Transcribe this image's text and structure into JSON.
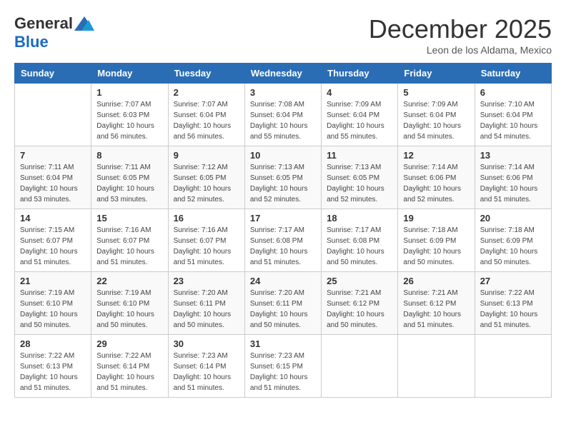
{
  "header": {
    "logo_general": "General",
    "logo_blue": "Blue",
    "month_title": "December 2025",
    "location": "Leon de los Aldama, Mexico"
  },
  "days_of_week": [
    "Sunday",
    "Monday",
    "Tuesday",
    "Wednesday",
    "Thursday",
    "Friday",
    "Saturday"
  ],
  "weeks": [
    [
      {
        "num": "",
        "sunrise": "",
        "sunset": "",
        "daylight": ""
      },
      {
        "num": "1",
        "sunrise": "Sunrise: 7:07 AM",
        "sunset": "Sunset: 6:03 PM",
        "daylight": "Daylight: 10 hours and 56 minutes."
      },
      {
        "num": "2",
        "sunrise": "Sunrise: 7:07 AM",
        "sunset": "Sunset: 6:04 PM",
        "daylight": "Daylight: 10 hours and 56 minutes."
      },
      {
        "num": "3",
        "sunrise": "Sunrise: 7:08 AM",
        "sunset": "Sunset: 6:04 PM",
        "daylight": "Daylight: 10 hours and 55 minutes."
      },
      {
        "num": "4",
        "sunrise": "Sunrise: 7:09 AM",
        "sunset": "Sunset: 6:04 PM",
        "daylight": "Daylight: 10 hours and 55 minutes."
      },
      {
        "num": "5",
        "sunrise": "Sunrise: 7:09 AM",
        "sunset": "Sunset: 6:04 PM",
        "daylight": "Daylight: 10 hours and 54 minutes."
      },
      {
        "num": "6",
        "sunrise": "Sunrise: 7:10 AM",
        "sunset": "Sunset: 6:04 PM",
        "daylight": "Daylight: 10 hours and 54 minutes."
      }
    ],
    [
      {
        "num": "7",
        "sunrise": "Sunrise: 7:11 AM",
        "sunset": "Sunset: 6:04 PM",
        "daylight": "Daylight: 10 hours and 53 minutes."
      },
      {
        "num": "8",
        "sunrise": "Sunrise: 7:11 AM",
        "sunset": "Sunset: 6:05 PM",
        "daylight": "Daylight: 10 hours and 53 minutes."
      },
      {
        "num": "9",
        "sunrise": "Sunrise: 7:12 AM",
        "sunset": "Sunset: 6:05 PM",
        "daylight": "Daylight: 10 hours and 52 minutes."
      },
      {
        "num": "10",
        "sunrise": "Sunrise: 7:13 AM",
        "sunset": "Sunset: 6:05 PM",
        "daylight": "Daylight: 10 hours and 52 minutes."
      },
      {
        "num": "11",
        "sunrise": "Sunrise: 7:13 AM",
        "sunset": "Sunset: 6:05 PM",
        "daylight": "Daylight: 10 hours and 52 minutes."
      },
      {
        "num": "12",
        "sunrise": "Sunrise: 7:14 AM",
        "sunset": "Sunset: 6:06 PM",
        "daylight": "Daylight: 10 hours and 52 minutes."
      },
      {
        "num": "13",
        "sunrise": "Sunrise: 7:14 AM",
        "sunset": "Sunset: 6:06 PM",
        "daylight": "Daylight: 10 hours and 51 minutes."
      }
    ],
    [
      {
        "num": "14",
        "sunrise": "Sunrise: 7:15 AM",
        "sunset": "Sunset: 6:07 PM",
        "daylight": "Daylight: 10 hours and 51 minutes."
      },
      {
        "num": "15",
        "sunrise": "Sunrise: 7:16 AM",
        "sunset": "Sunset: 6:07 PM",
        "daylight": "Daylight: 10 hours and 51 minutes."
      },
      {
        "num": "16",
        "sunrise": "Sunrise: 7:16 AM",
        "sunset": "Sunset: 6:07 PM",
        "daylight": "Daylight: 10 hours and 51 minutes."
      },
      {
        "num": "17",
        "sunrise": "Sunrise: 7:17 AM",
        "sunset": "Sunset: 6:08 PM",
        "daylight": "Daylight: 10 hours and 51 minutes."
      },
      {
        "num": "18",
        "sunrise": "Sunrise: 7:17 AM",
        "sunset": "Sunset: 6:08 PM",
        "daylight": "Daylight: 10 hours and 50 minutes."
      },
      {
        "num": "19",
        "sunrise": "Sunrise: 7:18 AM",
        "sunset": "Sunset: 6:09 PM",
        "daylight": "Daylight: 10 hours and 50 minutes."
      },
      {
        "num": "20",
        "sunrise": "Sunrise: 7:18 AM",
        "sunset": "Sunset: 6:09 PM",
        "daylight": "Daylight: 10 hours and 50 minutes."
      }
    ],
    [
      {
        "num": "21",
        "sunrise": "Sunrise: 7:19 AM",
        "sunset": "Sunset: 6:10 PM",
        "daylight": "Daylight: 10 hours and 50 minutes."
      },
      {
        "num": "22",
        "sunrise": "Sunrise: 7:19 AM",
        "sunset": "Sunset: 6:10 PM",
        "daylight": "Daylight: 10 hours and 50 minutes."
      },
      {
        "num": "23",
        "sunrise": "Sunrise: 7:20 AM",
        "sunset": "Sunset: 6:11 PM",
        "daylight": "Daylight: 10 hours and 50 minutes."
      },
      {
        "num": "24",
        "sunrise": "Sunrise: 7:20 AM",
        "sunset": "Sunset: 6:11 PM",
        "daylight": "Daylight: 10 hours and 50 minutes."
      },
      {
        "num": "25",
        "sunrise": "Sunrise: 7:21 AM",
        "sunset": "Sunset: 6:12 PM",
        "daylight": "Daylight: 10 hours and 50 minutes."
      },
      {
        "num": "26",
        "sunrise": "Sunrise: 7:21 AM",
        "sunset": "Sunset: 6:12 PM",
        "daylight": "Daylight: 10 hours and 51 minutes."
      },
      {
        "num": "27",
        "sunrise": "Sunrise: 7:22 AM",
        "sunset": "Sunset: 6:13 PM",
        "daylight": "Daylight: 10 hours and 51 minutes."
      }
    ],
    [
      {
        "num": "28",
        "sunrise": "Sunrise: 7:22 AM",
        "sunset": "Sunset: 6:13 PM",
        "daylight": "Daylight: 10 hours and 51 minutes."
      },
      {
        "num": "29",
        "sunrise": "Sunrise: 7:22 AM",
        "sunset": "Sunset: 6:14 PM",
        "daylight": "Daylight: 10 hours and 51 minutes."
      },
      {
        "num": "30",
        "sunrise": "Sunrise: 7:23 AM",
        "sunset": "Sunset: 6:14 PM",
        "daylight": "Daylight: 10 hours and 51 minutes."
      },
      {
        "num": "31",
        "sunrise": "Sunrise: 7:23 AM",
        "sunset": "Sunset: 6:15 PM",
        "daylight": "Daylight: 10 hours and 51 minutes."
      },
      {
        "num": "",
        "sunrise": "",
        "sunset": "",
        "daylight": ""
      },
      {
        "num": "",
        "sunrise": "",
        "sunset": "",
        "daylight": ""
      },
      {
        "num": "",
        "sunrise": "",
        "sunset": "",
        "daylight": ""
      }
    ]
  ]
}
